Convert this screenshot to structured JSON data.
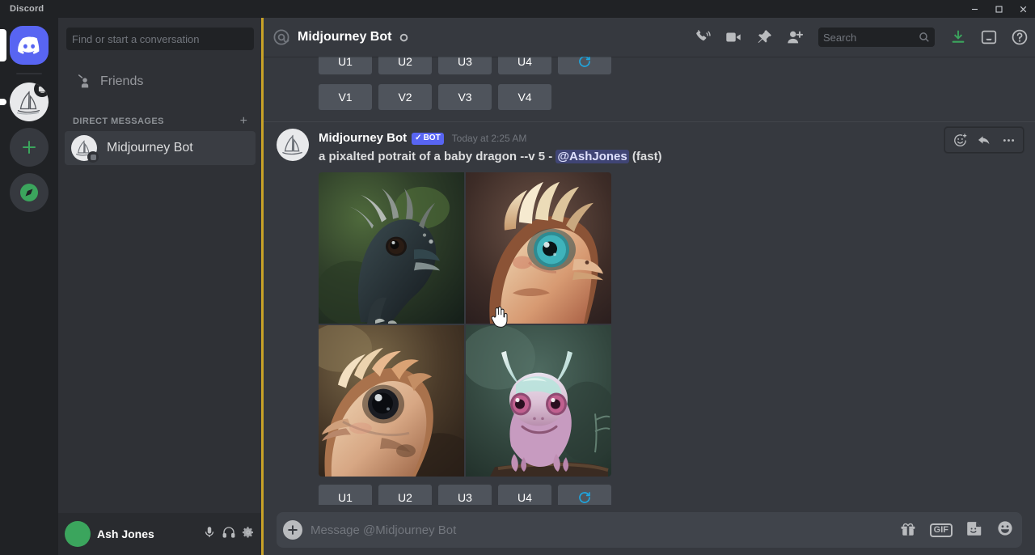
{
  "window": {
    "title": "Discord",
    "controls": {
      "minimize": "minimize-icon",
      "maximize": "maximize-icon",
      "close": "close-icon"
    }
  },
  "rail": {
    "items": [
      {
        "name": "home",
        "label": "Discord",
        "icon": "discord-logo-icon",
        "active": true
      },
      {
        "name": "midjourney-server",
        "label": "Midjourney",
        "icon": "sailboat-icon",
        "active": false
      },
      {
        "name": "add-server",
        "label": "Add a Server",
        "icon": "plus-icon",
        "active": false
      },
      {
        "name": "explore",
        "label": "Explore Public Servers",
        "icon": "compass-icon",
        "active": false
      }
    ]
  },
  "sidebar": {
    "search": {
      "placeholder": "Find or start a conversation",
      "value": ""
    },
    "nav": [
      {
        "label": "Friends",
        "icon": "friends-icon"
      }
    ],
    "dm_header": {
      "label": "DIRECT MESSAGES",
      "add_label": "+"
    },
    "dms": [
      {
        "label": "Midjourney Bot",
        "avatar": "sailboat-avatar",
        "active": true
      }
    ],
    "user": {
      "name": "Ash Jones",
      "icons": [
        "microphone-icon",
        "headphones-icon",
        "settings-gear-icon"
      ]
    }
  },
  "chat_header": {
    "at_symbol": "@",
    "title": "Midjourney Bot",
    "status": "offline",
    "tools": [
      {
        "name": "start-voice-call-icon",
        "label": "Start Voice Call"
      },
      {
        "name": "start-video-call-icon",
        "label": "Start Video Call"
      },
      {
        "name": "pinned-messages-icon",
        "label": "Pinned Messages"
      },
      {
        "name": "add-friends-icon",
        "label": "Add Friends to DM"
      }
    ],
    "search": {
      "placeholder": "Search",
      "value": "",
      "icon": "search-icon"
    },
    "right_tools": [
      {
        "name": "inbox-downloads-icon",
        "label": "Downloads",
        "color": "#3ba55d"
      },
      {
        "name": "inbox-icon",
        "label": "Inbox"
      },
      {
        "name": "help-icon",
        "label": "Help"
      }
    ]
  },
  "messages": {
    "top_partial": {
      "upscale_buttons": [
        "U1",
        "U2",
        "U3",
        "U4"
      ],
      "reroll_button": "reroll-icon",
      "variation_buttons": [
        "V1",
        "V2",
        "V3",
        "V4"
      ]
    },
    "current": {
      "author": "Midjourney Bot",
      "bot_tag": "BOT",
      "bot_tag_check": "✓",
      "timestamp": "Today at 2:25 AM",
      "prompt": "a pixalted potrait of a baby dragon --v 5",
      "separator": "-",
      "mention": "@AshJones",
      "speed": "(fast)",
      "upscale_buttons": [
        "U1",
        "U2",
        "U3",
        "U4"
      ],
      "reroll_button": "reroll-icon",
      "image_grid": {
        "cells": [
          {
            "name": "image-quadrant-1",
            "alt": "dark blue-green baby dragon in forest"
          },
          {
            "name": "image-quadrant-2",
            "alt": "cream and orange baby dragon with teal eye"
          },
          {
            "name": "image-quadrant-3",
            "alt": "tan peach baby dragon on branch"
          },
          {
            "name": "image-quadrant-4",
            "alt": "pink lavender baby dragon with teal crest"
          }
        ]
      }
    },
    "hover_tools": [
      {
        "name": "add-reaction-icon",
        "label": "Add Reaction"
      },
      {
        "name": "reply-icon",
        "label": "Reply"
      },
      {
        "name": "more-options-icon",
        "label": "More"
      }
    ]
  },
  "composer": {
    "add_label": "+",
    "placeholder": "Message @Midjourney Bot",
    "value": "",
    "icons": [
      {
        "name": "gift-icon",
        "label": "Gift"
      },
      {
        "name": "gif-icon",
        "label": "GIF"
      },
      {
        "name": "sticker-icon",
        "label": "Sticker"
      },
      {
        "name": "emoji-icon",
        "label": "Emoji"
      }
    ],
    "gif_label": "GIF"
  },
  "colors": {
    "brand": "#5865f2",
    "chat_bg": "#36393f",
    "sidebar_bg": "#2f3136",
    "rail_bg": "#202225",
    "green": "#3ba55d",
    "button_bg": "#4f545c",
    "reroll_blue": "#1ea7e1",
    "highlight_line": "#c9a227"
  }
}
